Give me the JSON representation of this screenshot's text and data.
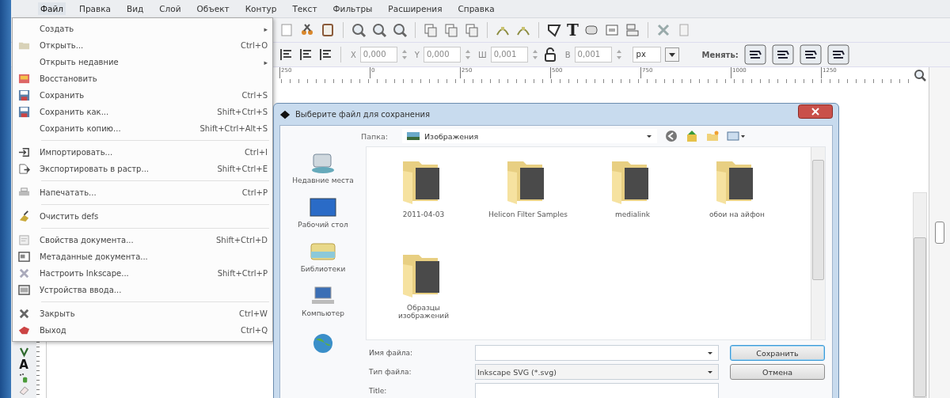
{
  "menu_bar": [
    {
      "label": "Файл",
      "selected": true
    },
    {
      "label": "Правка",
      "selected": false
    },
    {
      "label": "Вид",
      "selected": false
    },
    {
      "label": "Слой",
      "selected": false
    },
    {
      "label": "Объект",
      "selected": false
    },
    {
      "label": "Контур",
      "selected": false
    },
    {
      "label": "Текст",
      "selected": false
    },
    {
      "label": "Фильтры",
      "selected": false
    },
    {
      "label": "Расширения",
      "selected": false
    },
    {
      "label": "Справка",
      "selected": false
    }
  ],
  "file_menu": [
    {
      "kind": "item",
      "label": "Создать",
      "arrow": "▸"
    },
    {
      "kind": "item",
      "label": "Открыть...",
      "shortcut": "Ctrl+O"
    },
    {
      "kind": "item",
      "label": "Открыть недавние",
      "arrow": "▸"
    },
    {
      "kind": "item",
      "label": "Восстановить"
    },
    {
      "kind": "item",
      "label": "Сохранить",
      "shortcut": "Ctrl+S"
    },
    {
      "kind": "item",
      "label": "Сохранить как...",
      "shortcut": "Shift+Ctrl+S"
    },
    {
      "kind": "item",
      "label": "Сохранить копию...",
      "shortcut": "Shift+Ctrl+Alt+S"
    },
    {
      "kind": "separator"
    },
    {
      "kind": "item",
      "label": "Импортировать...",
      "shortcut": "Ctrl+I"
    },
    {
      "kind": "item",
      "label": "Экспортировать в растр...",
      "shortcut": "Shift+Ctrl+E"
    },
    {
      "kind": "separator"
    },
    {
      "kind": "item",
      "label": "Напечатать...",
      "shortcut": "Ctrl+P"
    },
    {
      "kind": "separator"
    },
    {
      "kind": "item",
      "label": "Очистить defs"
    },
    {
      "kind": "separator"
    },
    {
      "kind": "item",
      "label": "Свойства документа...",
      "shortcut": "Shift+Ctrl+D"
    },
    {
      "kind": "item",
      "label": "Метаданные документа..."
    },
    {
      "kind": "item",
      "label": "Настроить Inkscape...",
      "shortcut": "Shift+Ctrl+P"
    },
    {
      "kind": "item",
      "label": "Устройства ввода..."
    },
    {
      "kind": "separator"
    },
    {
      "kind": "item",
      "label": "Закрыть",
      "shortcut": "Ctrl+W"
    },
    {
      "kind": "item",
      "label": "Выход",
      "shortcut": "Ctrl+Q"
    }
  ],
  "toolbar": {
    "text_tool_glyph": "T"
  },
  "tool_controls": {
    "fields": [
      {
        "label": "X",
        "value": "0,000"
      },
      {
        "label": "Y",
        "value": "0,000"
      },
      {
        "label": "Ш",
        "value": "0,001"
      },
      {
        "label": "В",
        "value": "0,001"
      }
    ],
    "unit": "px",
    "transform_label": "Менять:"
  },
  "ruler_labels": [
    "250",
    "0",
    "250",
    "500",
    "750",
    "1000",
    "1250"
  ],
  "toolbox": {
    "text_tool_glyph": "A"
  },
  "dialog": {
    "title": "Выберите файл для сохранения",
    "folder_label": "Папка:",
    "folder": "Изображения",
    "places": [
      {
        "label": "Недавние места"
      },
      {
        "label": "Рабочий стол"
      },
      {
        "label": "Библиотеки"
      },
      {
        "label": "Компьютер"
      }
    ],
    "folders": [
      {
        "name": "2011-04-03"
      },
      {
        "name": "Helicon Filter Samples"
      },
      {
        "name": "medialink"
      },
      {
        "name": "обои на айфон"
      },
      {
        "name": "Образцы изображений"
      }
    ],
    "file_name_label": "Имя файла:",
    "file_type_label": "Тип файла:",
    "file_type": "Inkscape SVG (*.svg)",
    "title_label": "Title:",
    "buttons": [
      "Сохранить",
      "Отмена"
    ]
  }
}
